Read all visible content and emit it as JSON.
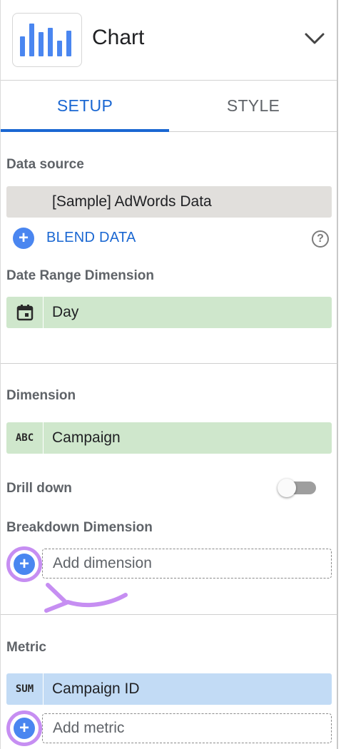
{
  "header": {
    "title": "Chart",
    "chart_icon": "bar-chart-icon",
    "chevron_icon": "chevron-down-icon"
  },
  "tabs": [
    {
      "label": "SETUP",
      "active": true
    },
    {
      "label": "STYLE",
      "active": false
    }
  ],
  "data_source": {
    "label": "Data source",
    "value": "[Sample] AdWords Data"
  },
  "blend": {
    "label": "BLEND DATA",
    "icon": "add-circle-icon",
    "help_icon": "help-icon"
  },
  "date_range": {
    "label": "Date Range Dimension",
    "icon": "calendar-icon",
    "value": "Day"
  },
  "dimension": {
    "label": "Dimension",
    "type_badge": "ABC",
    "value": "Campaign"
  },
  "drill_down": {
    "label": "Drill down",
    "enabled": false
  },
  "breakdown": {
    "label": "Breakdown Dimension",
    "placeholder": "Add dimension"
  },
  "metric": {
    "label": "Metric",
    "type_badge": "SUM",
    "value": "Campaign ID",
    "placeholder": "Add metric"
  },
  "colors": {
    "accent_blue": "#1a67d2",
    "plus_blue": "#4a86f0",
    "dimension_green": "#cfe7cc",
    "metric_blue": "#c2dbf5",
    "source_grey": "#e1dfdc",
    "annotation_purple": "#c68ef2"
  }
}
